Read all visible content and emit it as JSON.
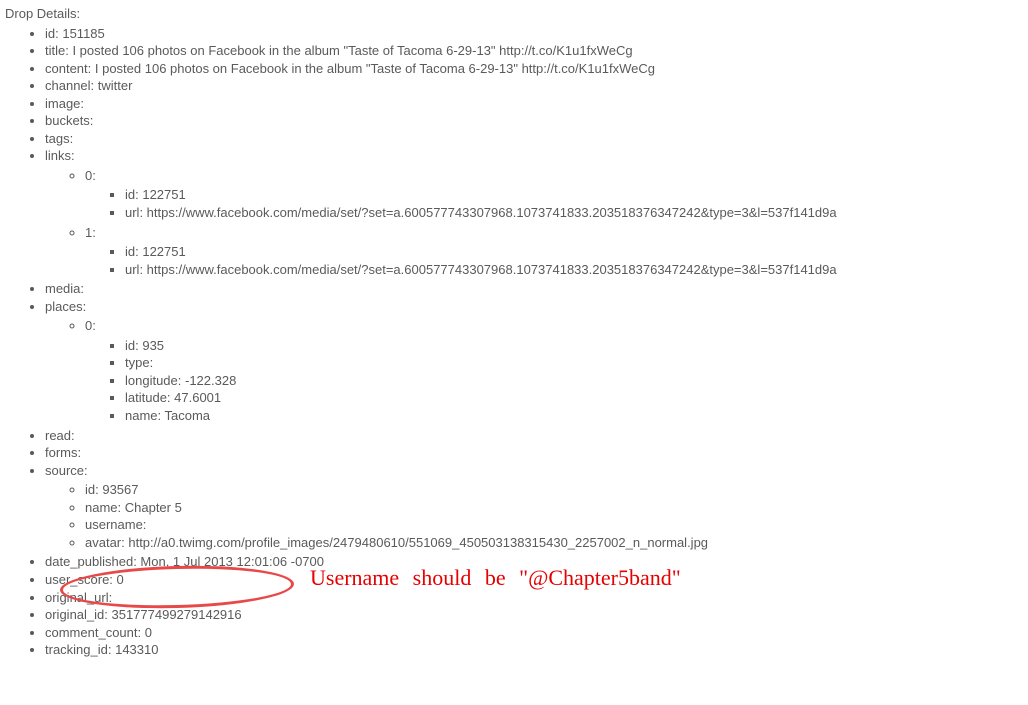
{
  "header": "Drop Details:",
  "drop": {
    "id": "id: 151185",
    "title": "title: I posted 106 photos on Facebook in the album \"Taste of Tacoma 6-29-13\" http://t.co/K1u1fxWeCg",
    "content": "content: I posted 106 photos on Facebook in the album \"Taste of Tacoma 6-29-13\" http://t.co/K1u1fxWeCg",
    "channel": "channel: twitter",
    "image": "image:",
    "buckets": "buckets:",
    "tags": "tags:",
    "links_label": "links:",
    "links": {
      "idx0_label": "0:",
      "idx0": {
        "id": "id: 122751",
        "url": "url: https://www.facebook.com/media/set/?set=a.600577743307968.1073741833.203518376347242&type=3&l=537f141d9a"
      },
      "idx1_label": "1:",
      "idx1": {
        "id": "id: 122751",
        "url": "url: https://www.facebook.com/media/set/?set=a.600577743307968.1073741833.203518376347242&type=3&l=537f141d9a"
      }
    },
    "media": "media:",
    "places_label": "places:",
    "places": {
      "idx0_label": "0:",
      "idx0": {
        "id": "id: 935",
        "type": "type:",
        "longitude": "longitude: -122.328",
        "latitude": "latitude: 47.6001",
        "name": "name: Tacoma"
      }
    },
    "read": "read:",
    "forms": "forms:",
    "source_label": "source:",
    "source": {
      "id": "id: 93567",
      "name": "name: Chapter 5",
      "username": "username:",
      "avatar": "avatar: http://a0.twimg.com/profile_images/2479480610/551069_450503138315430_2257002_n_normal.jpg"
    },
    "date_published": "date_published: Mon, 1 Jul 2013 12:01:06 -0700",
    "user_score": "user_score: 0",
    "original_url": "original_url:",
    "original_id": "original_id: 351777499279142916",
    "comment_count": "comment_count: 0",
    "tracking_id": "tracking_id: 143310"
  },
  "annotation": {
    "text": "Username should be \"@Chapter5band\""
  }
}
